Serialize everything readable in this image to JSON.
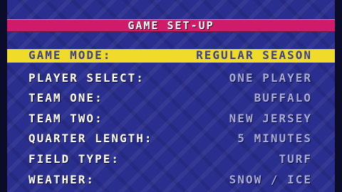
{
  "screen": {
    "title": "GAME SET-UP"
  },
  "options": [
    {
      "label": "GAME MODE:",
      "value": "REGULAR SEASON",
      "selected": true
    },
    {
      "label": "PLAYER SELECT:",
      "value": "ONE PLAYER",
      "selected": false
    },
    {
      "label": "TEAM ONE:",
      "value": "BUFFALO",
      "selected": false
    },
    {
      "label": "TEAM TWO:",
      "value": "NEW JERSEY",
      "selected": false
    },
    {
      "label": "QUARTER LENGTH:",
      "value": "5 MINUTES",
      "selected": false
    },
    {
      "label": "FIELD TYPE:",
      "value": "TURF",
      "selected": false
    },
    {
      "label": "WEATHER:",
      "value": "SNOW / ICE",
      "selected": false
    }
  ],
  "colors": {
    "background": "#2a2e8e",
    "title_bar": "#d01a6a",
    "highlight": "#f0da2a",
    "label_text": "#ffffff",
    "value_text": "#a9acd8"
  }
}
